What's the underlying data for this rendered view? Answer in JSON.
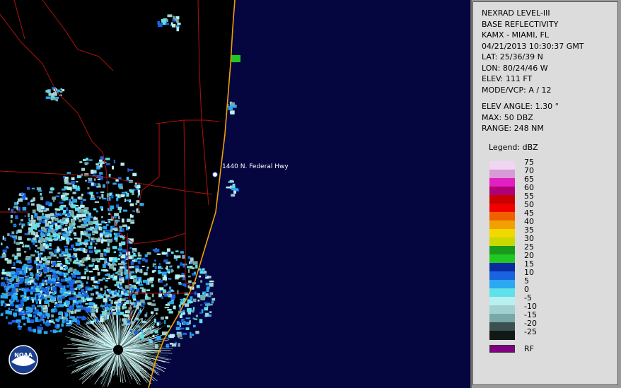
{
  "product": {
    "line1": "NEXRAD LEVEL-III",
    "line2": "BASE REFLECTIVITY",
    "station": "KAMX - MIAMI, FL",
    "datetime": "04/21/2013 10:30:37 GMT",
    "lat": "LAT: 25/36/39 N",
    "lon": "LON: 80/24/46 W",
    "elev": "ELEV: 111 FT",
    "mode": "MODE/VCP: A / 12",
    "elev_angle": "ELEV ANGLE: 1.30 °",
    "max": "MAX: 50 DBZ",
    "range": "RANGE: 248 NM"
  },
  "legend": {
    "title": "Legend: dBZ",
    "levels": [
      "75",
      "70",
      "65",
      "60",
      "55",
      "50",
      "45",
      "40",
      "35",
      "30",
      "25",
      "20",
      "15",
      "10",
      "5",
      "0",
      "-5",
      "-10",
      "-15",
      "-20",
      "-25"
    ],
    "colors": [
      "#f0d6f0",
      "#d79bd8",
      "#e020c0",
      "#b00078",
      "#c80000",
      "#f00000",
      "#f06000",
      "#f0a000",
      "#f0d800",
      "#c8d800",
      "#1a9a1a",
      "#22c822",
      "#0a2aa0",
      "#1a62e0",
      "#2aa8f0",
      "#60e0e8",
      "#b8f0f0",
      "#a0d0d0",
      "#78a8a8",
      "#3c5050",
      "#101818"
    ],
    "rf_label": "RF",
    "rf_color": "#800080"
  },
  "map": {
    "marker_label": "1440 N. Federal Hwy",
    "logo_text": "NOAA",
    "ocean_color": "#050540",
    "land_color": "#000000",
    "coast_color": "#f0a000",
    "road_color": "#b01010"
  }
}
